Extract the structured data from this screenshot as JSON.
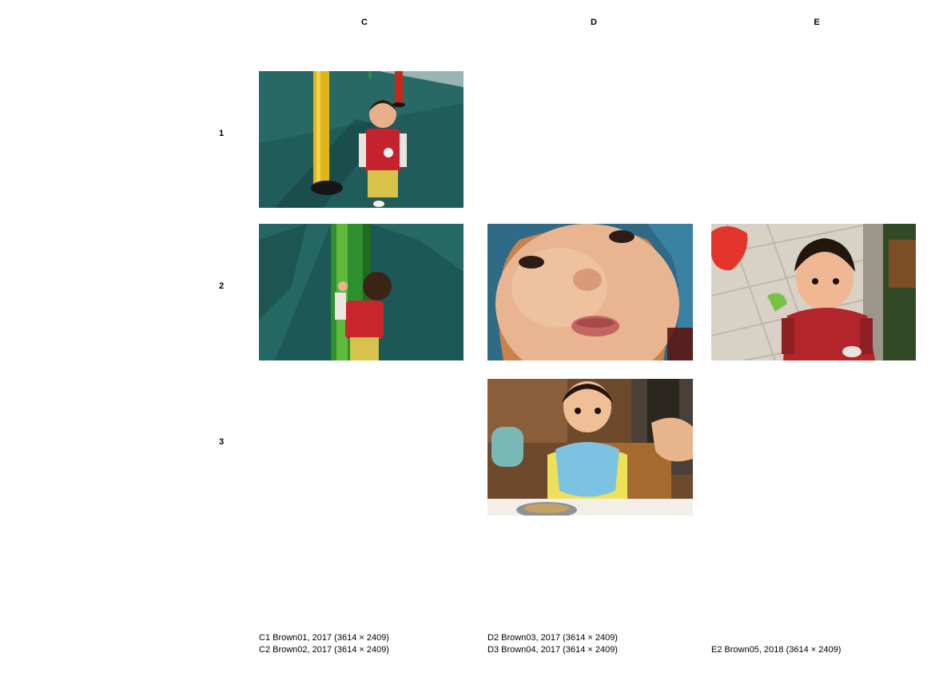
{
  "columns": [
    {
      "id": "C",
      "label": "C"
    },
    {
      "id": "D",
      "label": "D"
    },
    {
      "id": "E",
      "label": "E"
    }
  ],
  "rows": [
    {
      "label": "1"
    },
    {
      "label": "2"
    },
    {
      "label": "3"
    }
  ],
  "photos": [
    {
      "cell": "C1",
      "subject": "toddler in red vest walking past yellow and red poles on playground"
    },
    {
      "cell": "C2",
      "subject": "toddler hugging a green pole on playground"
    },
    {
      "cell": "D2",
      "subject": "close-up blurry face of baby wearing blue hood"
    },
    {
      "cell": "D3",
      "subject": "baby in high chair with blue bib eating from metal bowl"
    },
    {
      "cell": "E2",
      "subject": "toddler in red knitted vest on tiled sidewalk"
    }
  ],
  "captions": {
    "c": [
      "C1 Brown01, 2017 (3614  × 2409)",
      "C2 Brown02, 2017 (3614  × 2409)"
    ],
    "d": [
      "D2 Brown03, 2017 (3614  × 2409)",
      "D3 Brown04, 2017 (3614  × 2409)"
    ],
    "e": [
      "E2 Brown05, 2018 (3614 × 2409)"
    ]
  }
}
